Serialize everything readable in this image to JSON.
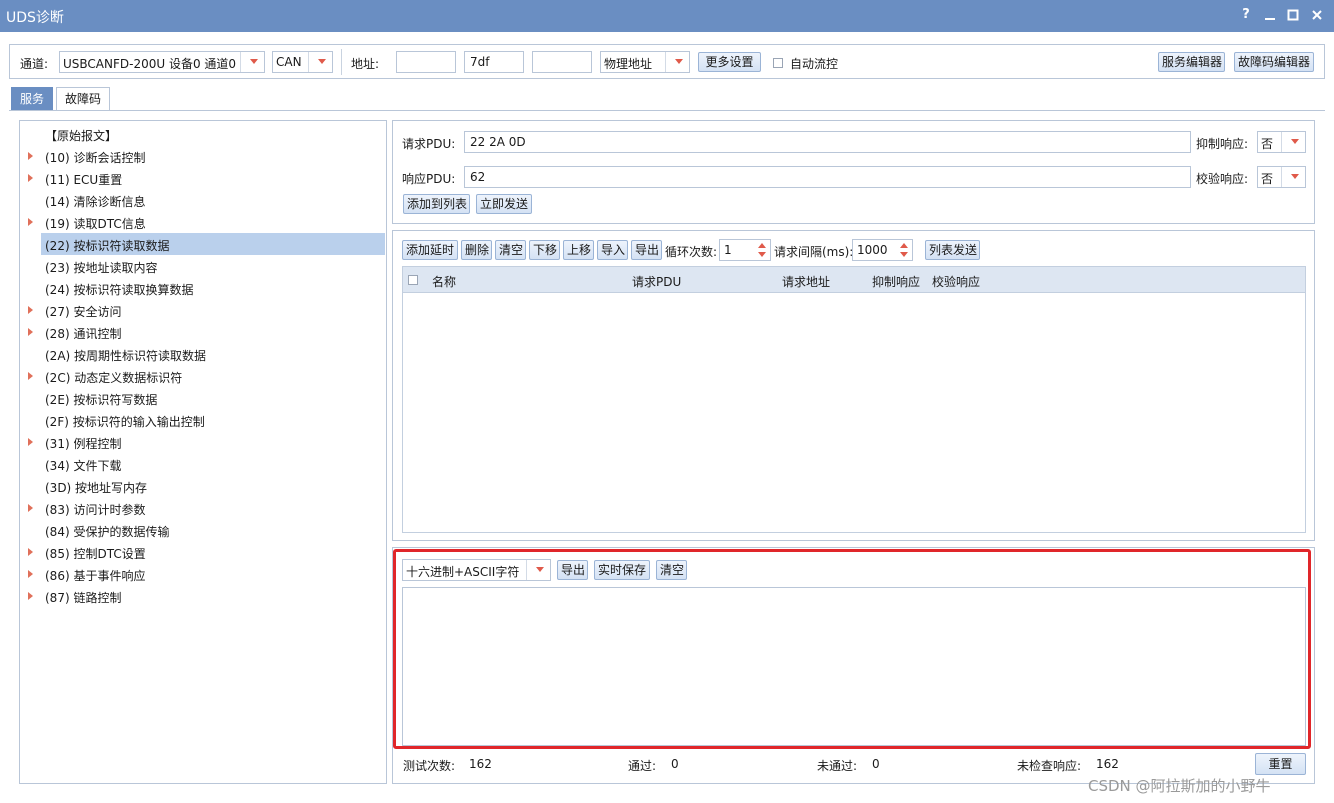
{
  "window": {
    "title": "UDS诊断",
    "help_icon": "?",
    "minimize_icon": "minimize-icon",
    "maximize_icon": "maximize-icon",
    "close_icon": "close-icon"
  },
  "toolbar": {
    "channel_label": "通道:",
    "channel_value": "USBCANFD-200U 设备0 通道0",
    "protocol_value": "CAN",
    "address_label": "地址:",
    "address1": "",
    "address2": "7df",
    "address3": "",
    "address_type": "物理地址",
    "more_settings": "更多设置",
    "auto_flow_label": "自动流控",
    "service_editor": "服务编辑器",
    "dtc_editor": "故障码编辑器"
  },
  "tabs": [
    {
      "label": "服务",
      "active": true
    },
    {
      "label": "故障码",
      "active": false
    }
  ],
  "services": [
    {
      "label": "【原始报文】",
      "expandable": false
    },
    {
      "label": "(10) 诊断会话控制",
      "expandable": true
    },
    {
      "label": "(11) ECU重置",
      "expandable": true
    },
    {
      "label": "(14) 清除诊断信息",
      "expandable": false
    },
    {
      "label": "(19) 读取DTC信息",
      "expandable": true
    },
    {
      "label": "(22) 按标识符读取数据",
      "expandable": false,
      "selected": true
    },
    {
      "label": "(23) 按地址读取内容",
      "expandable": false
    },
    {
      "label": "(24) 按标识符读取换算数据",
      "expandable": false
    },
    {
      "label": "(27) 安全访问",
      "expandable": true
    },
    {
      "label": "(28) 通讯控制",
      "expandable": true
    },
    {
      "label": "(2A) 按周期性标识符读取数据",
      "expandable": false
    },
    {
      "label": "(2C) 动态定义数据标识符",
      "expandable": true
    },
    {
      "label": "(2E) 按标识符写数据",
      "expandable": false
    },
    {
      "label": "(2F) 按标识符的输入输出控制",
      "expandable": false
    },
    {
      "label": "(31) 例程控制",
      "expandable": true
    },
    {
      "label": "(34) 文件下载",
      "expandable": false
    },
    {
      "label": "(3D) 按地址写内存",
      "expandable": false
    },
    {
      "label": "(83) 访问计时参数",
      "expandable": true
    },
    {
      "label": "(84) 受保护的数据传输",
      "expandable": false
    },
    {
      "label": "(85) 控制DTC设置",
      "expandable": true
    },
    {
      "label": "(86) 基于事件响应",
      "expandable": true
    },
    {
      "label": "(87) 链路控制",
      "expandable": true
    }
  ],
  "request": {
    "req_label": "请求PDU:",
    "req_value": "22 2A 0D",
    "suppress_label": "抑制响应:",
    "suppress_value": "否",
    "resp_label": "响应PDU:",
    "resp_value": "62",
    "verify_label": "校验响应:",
    "verify_value": "否",
    "add_to_list": "添加到列表",
    "send_now": "立即发送"
  },
  "list_toolbar": {
    "add_delay": "添加延时",
    "delete": "删除",
    "clear": "清空",
    "move_down": "下移",
    "move_up": "上移",
    "import": "导入",
    "export": "导出",
    "loop_label": "循环次数:",
    "loop_value": "1",
    "interval_label": "请求间隔(ms):",
    "interval_value": "1000",
    "list_send": "列表发送"
  },
  "list_columns": [
    "名称",
    "请求PDU",
    "请求地址",
    "抑制响应",
    "校验响应"
  ],
  "log": {
    "format_value": "十六进制+ASCII字符",
    "export": "导出",
    "realtime_save": "实时保存",
    "clear": "清空"
  },
  "status": {
    "test_count_label": "测试次数:",
    "test_count": "162",
    "pass_label": "通过:",
    "pass": "0",
    "fail_label": "未通过:",
    "fail": "0",
    "unchecked_label": "未检查响应:",
    "unchecked": "162",
    "reset": "重置"
  },
  "watermark": "CSDN @阿拉斯加的小野牛",
  "colors": {
    "accent": "#6a8ec2",
    "highlight": "#e0262a",
    "selection": "#bad0ec"
  }
}
